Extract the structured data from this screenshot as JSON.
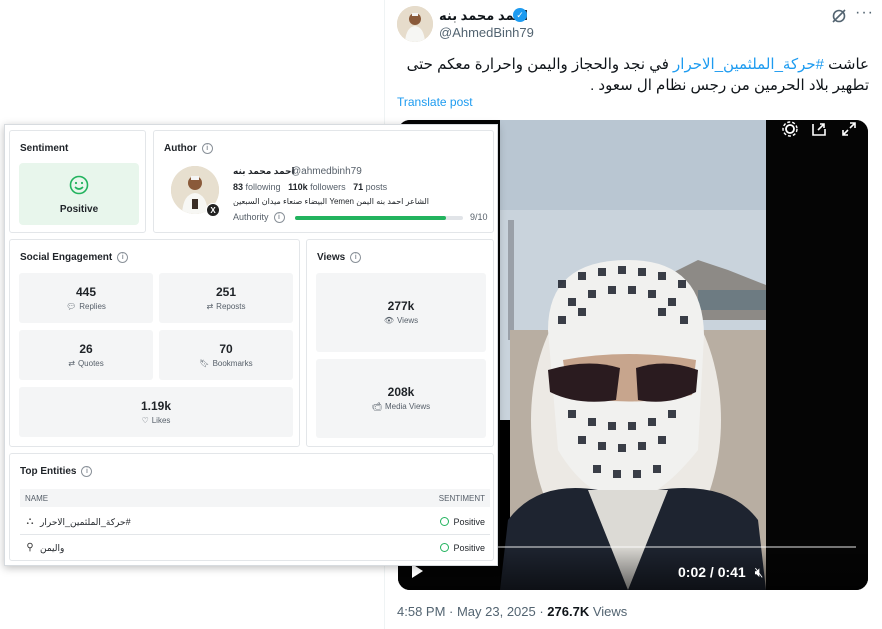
{
  "tweet": {
    "author_name": "احمد محمد بنه",
    "handle": "@AhmedBinh79",
    "text_prefix": "عاشت ",
    "hashtag": "#حركة_الملثمين_الاحرار",
    "text_suffix": " في نجد والحجاز واليمن واحرارة معكم حتى تطهير بلاد الحرمين من رجس نظام ال سعود .",
    "translate_label": "Translate post",
    "video_time": "0:02 / 0:41",
    "video_progress": 0.05,
    "timestamp": "4:58 PM · May 23, 2025 · ",
    "views_count": "276.7K",
    "views_label": " Views",
    "icons": [
      "grok-icon",
      "more-icon",
      "play-icon",
      "mute-icon",
      "settings-icon",
      "pip-icon",
      "fullscreen-icon"
    ]
  },
  "panel": {
    "sentiment": {
      "title": "Sentiment",
      "value": "Positive",
      "color": "#22b35e"
    },
    "author": {
      "title": "Author",
      "name": "احمد محمد بنه",
      "handle": "@ahmedbinh79",
      "following_count": "83",
      "following_label": " following",
      "followers_count": "110k",
      "followers_label": " followers",
      "posts_count": "71",
      "posts_label": " posts",
      "bio": "البيضاء صنعاء ميدان السبعين Yemen الشاعر احمد بنه اليمن",
      "authority_label": "Authority",
      "authority_value": "9/10",
      "authority_fraction": 0.9
    },
    "engagement": {
      "title": "Social Engagement",
      "replies": {
        "value": "445",
        "label": "Replies"
      },
      "reposts": {
        "value": "251",
        "label": "Reposts"
      },
      "quotes": {
        "value": "26",
        "label": "Quotes"
      },
      "bookmarks": {
        "value": "70",
        "label": "Bookmarks"
      },
      "likes": {
        "value": "1.19k",
        "label": "Likes"
      }
    },
    "views": {
      "title": "Views",
      "views": {
        "value": "277k",
        "label": "Views"
      },
      "media_views": {
        "value": "208k",
        "label": "Media Views"
      }
    },
    "entities": {
      "title": "Top Entities",
      "col_name": "NAME",
      "col_sentiment": "SENTIMENT",
      "rows": [
        {
          "icon": "network-icon",
          "name": "حركة_الملثمين_الاحرار#",
          "sentiment": "Positive"
        },
        {
          "icon": "location-pin-icon",
          "name": "واليمن",
          "sentiment": "Positive"
        }
      ]
    }
  }
}
